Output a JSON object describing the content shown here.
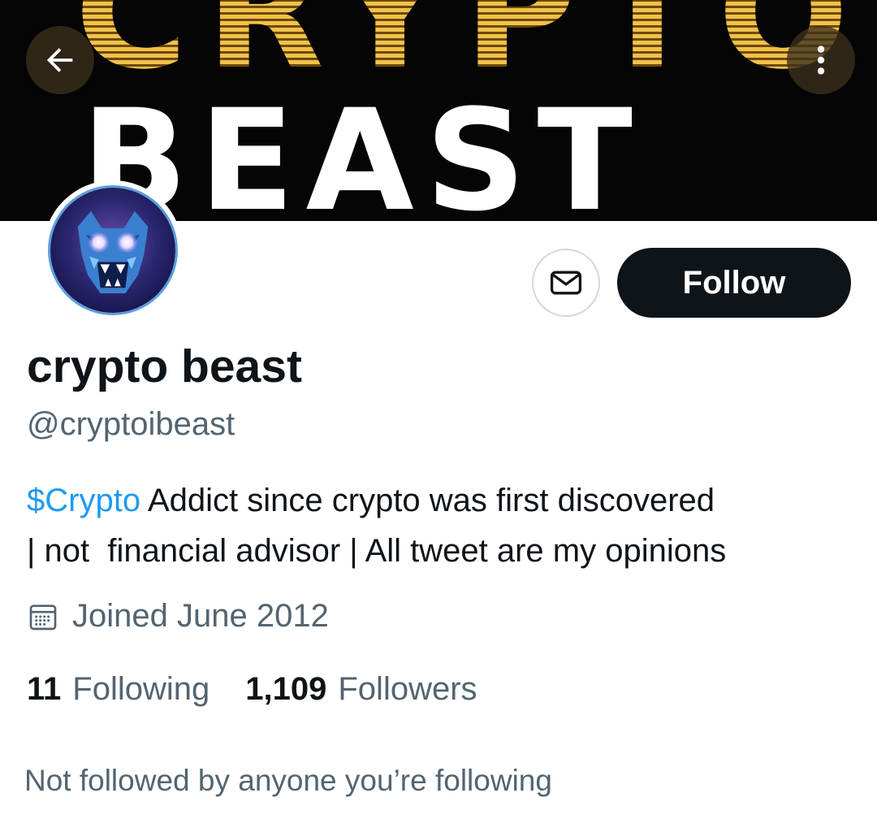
{
  "banner": {
    "top_text": "CRYPTO",
    "main_text": "BEAST"
  },
  "header": {
    "back_icon": "arrow-left-icon",
    "more_icon": "more-vertical-icon"
  },
  "profile": {
    "avatar_icon": "bear-avatar",
    "message_icon": "envelope-icon",
    "follow_label": "Follow",
    "name": "crypto beast",
    "handle": "@cryptoibeast",
    "bio": {
      "cashtag": "$Crypto",
      "line1_rest": " Addict since crypto was first discovered",
      "line2": "| not  financial advisor | All tweet are my opinions"
    },
    "joined_icon": "calendar-icon",
    "joined": "Joined June 2012",
    "following_count": "11",
    "following_label": "Following",
    "followers_count": "1,109",
    "followers_label": "Followers",
    "not_followed": "Not followed by anyone you’re following"
  },
  "colors": {
    "link": "#1d9bf0",
    "secondary_text": "#536471",
    "primary_text": "#0f1419",
    "follow_button_bg": "#0f1419"
  }
}
